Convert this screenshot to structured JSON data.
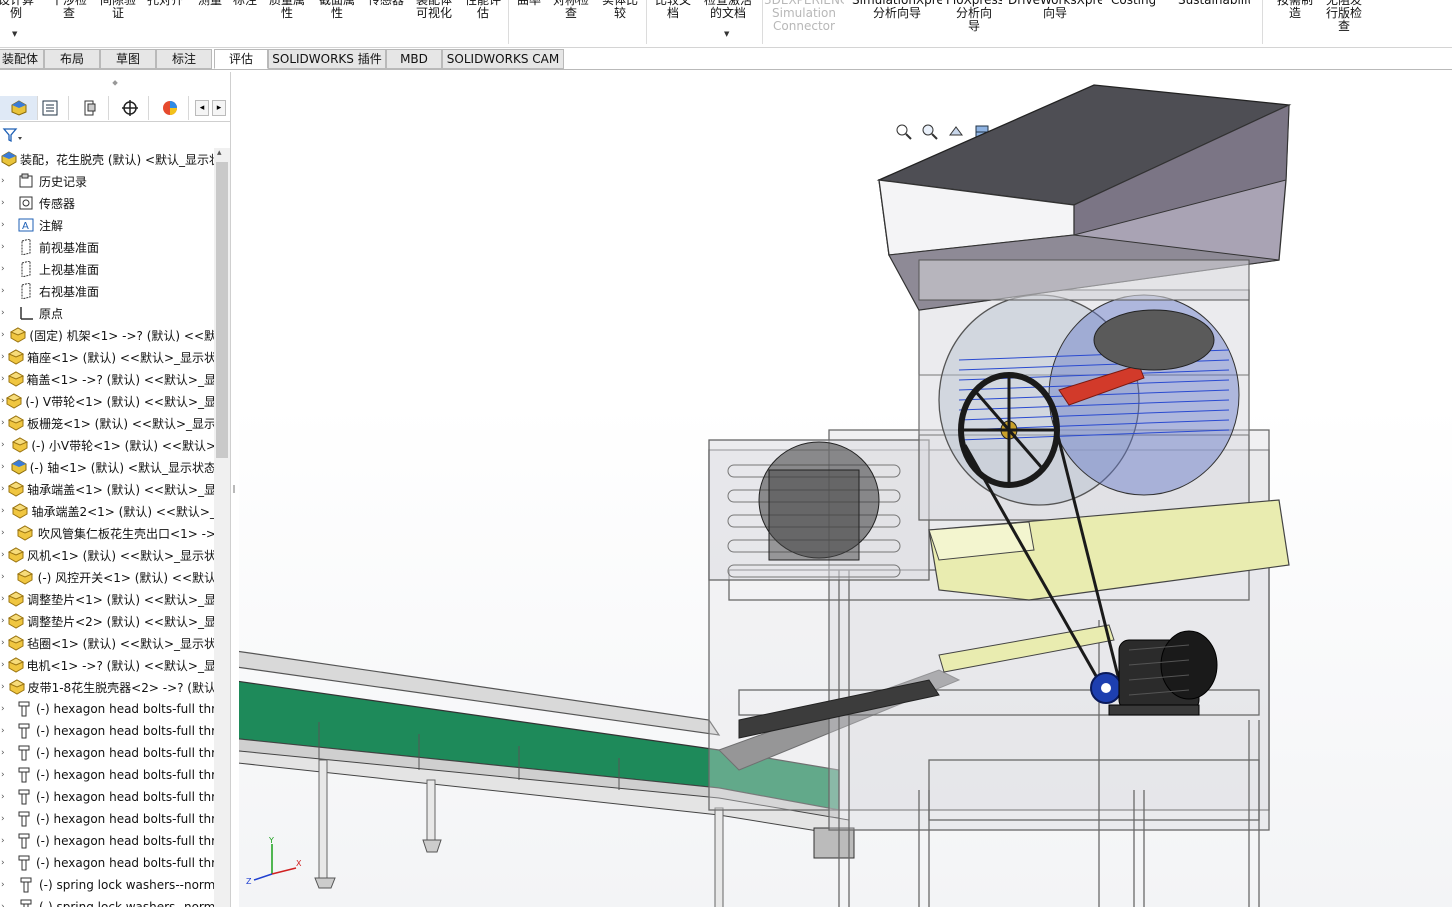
{
  "ribbon": {
    "items": [
      {
        "label": "设计算\n例",
        "disabled": false
      },
      {
        "label": "干涉检\n查",
        "disabled": false
      },
      {
        "label": "间隙验\n证",
        "disabled": false
      },
      {
        "label": "孔对齐",
        "disabled": false
      },
      {
        "label": "测量",
        "disabled": false
      },
      {
        "label": "标注",
        "disabled": false
      },
      {
        "label": "质量属\n性",
        "disabled": false
      },
      {
        "label": "截面属\n性",
        "disabled": false
      },
      {
        "label": "传感器",
        "disabled": false
      },
      {
        "label": "装配体\n可视化",
        "disabled": false
      },
      {
        "label": "性能评\n估",
        "disabled": false
      },
      {
        "label": "曲率",
        "disabled": false
      },
      {
        "label": "对称检\n查",
        "disabled": false
      },
      {
        "label": "实体比\n较",
        "disabled": false
      },
      {
        "label": "比较文\n档",
        "disabled": false
      },
      {
        "label": "检查激活\n的文档",
        "disabled": false
      },
      {
        "label": "3DEXPERIENCE\nSimulation\nConnector",
        "disabled": true
      },
      {
        "label": "SimulationXpress\n分析向导",
        "disabled": false
      },
      {
        "label": "FloXpress\n分析向\n导",
        "disabled": false
      },
      {
        "label": "DriveWorksXpress\n向导",
        "disabled": false
      },
      {
        "label": "Costing",
        "disabled": false
      },
      {
        "label": "Sustainability",
        "disabled": false
      },
      {
        "label": "按需制\n造",
        "disabled": false
      },
      {
        "label": "无阻发\n行版检\n查",
        "disabled": false
      }
    ]
  },
  "tabs": [
    {
      "label": "装配体",
      "active": false
    },
    {
      "label": "布局",
      "active": false
    },
    {
      "label": "草图",
      "active": false
    },
    {
      "label": "标注",
      "active": false
    },
    {
      "label": "评估",
      "active": true
    },
    {
      "label": "SOLIDWORKS 插件",
      "active": false
    },
    {
      "label": "MBD",
      "active": false
    },
    {
      "label": "SOLIDWORKS CAM",
      "active": false
    }
  ],
  "panel": {
    "tabs": [
      "feature-manager",
      "property-manager",
      "configuration-manager",
      "dimxpert-manager",
      "display-manager"
    ]
  },
  "tree": {
    "items": [
      {
        "label": "装配，花生脱壳 (默认) <默认_显示状",
        "icon": "assembly-icon"
      },
      {
        "label": "历史记录",
        "icon": "history-icon"
      },
      {
        "label": "传感器",
        "icon": "sensor-icon"
      },
      {
        "label": "注解",
        "icon": "annotation-icon"
      },
      {
        "label": "前视基准面",
        "icon": "plane-icon"
      },
      {
        "label": "上视基准面",
        "icon": "plane-icon"
      },
      {
        "label": "右视基准面",
        "icon": "plane-icon"
      },
      {
        "label": "原点",
        "icon": "origin-icon"
      },
      {
        "label": "(固定) 机架<1> ->? (默认) <<默",
        "icon": "part-icon"
      },
      {
        "label": "箱座<1> (默认) <<默认>_显示状",
        "icon": "part-icon"
      },
      {
        "label": "箱盖<1> ->? (默认) <<默认>_显",
        "icon": "part-icon"
      },
      {
        "label": "(-) V带轮<1> (默认) <<默认>_显",
        "icon": "part-icon"
      },
      {
        "label": "板栅笼<1> (默认) <<默认>_显示",
        "icon": "part-icon"
      },
      {
        "label": "(-) 小V带轮<1> (默认) <<默认>",
        "icon": "part-icon"
      },
      {
        "label": "(-) 轴<1> (默认) <默认_显示状态",
        "icon": "subassembly-icon"
      },
      {
        "label": "轴承端盖<1> (默认) <<默认>_显",
        "icon": "part-icon"
      },
      {
        "label": "轴承端盖2<1> (默认) <<默认>_",
        "icon": "part-icon"
      },
      {
        "label": "吹风管集仁板花生壳出口<1> ->",
        "icon": "part-icon"
      },
      {
        "label": "风机<1> (默认) <<默认>_显示状",
        "icon": "part-icon"
      },
      {
        "label": "(-) 风控开关<1> (默认) <<默认",
        "icon": "part-icon"
      },
      {
        "label": "调整垫片<1> (默认) <<默认>_显",
        "icon": "part-icon"
      },
      {
        "label": "调整垫片<2> (默认) <<默认>_显",
        "icon": "part-icon"
      },
      {
        "label": "毡圈<1> (默认) <<默认>_显示状",
        "icon": "part-icon"
      },
      {
        "label": "电机<1> ->? (默认) <<默认>_显",
        "icon": "part-icon"
      },
      {
        "label": "皮带1-8花生脱壳器<2> ->? (默认",
        "icon": "part-icon"
      },
      {
        "label": "(-) hexagon head bolts-full thr",
        "icon": "bolt-icon"
      },
      {
        "label": "(-) hexagon head bolts-full thr",
        "icon": "bolt-icon"
      },
      {
        "label": "(-) hexagon head bolts-full thr",
        "icon": "bolt-icon"
      },
      {
        "label": "(-) hexagon head bolts-full thr",
        "icon": "bolt-icon"
      },
      {
        "label": "(-) hexagon head bolts-full thr",
        "icon": "bolt-icon"
      },
      {
        "label": "(-) hexagon head bolts-full thr",
        "icon": "bolt-icon"
      },
      {
        "label": "(-) hexagon head bolts-full thr",
        "icon": "bolt-icon"
      },
      {
        "label": "(-) hexagon head bolts-full thr",
        "icon": "bolt-icon"
      },
      {
        "label": "(-) spring lock washers--norm",
        "icon": "washer-icon"
      },
      {
        "label": "(-) spring lock washers--norm",
        "icon": "washer-icon"
      }
    ]
  },
  "hud": {
    "icons": [
      "zoom-to-fit-icon",
      "zoom-to-area-icon",
      "previous-view-icon",
      "section-view-icon",
      "dynamic-annotation-icon",
      "view-orientation-icon",
      "display-style-icon",
      "hide-show-items-icon",
      "edit-appearance-icon",
      "apply-scene-icon",
      "view-settings-icon"
    ]
  },
  "colors": {
    "accent": "#2f6fbd",
    "conveyor_belt": "#1e8a5a",
    "hopper": "#a9a3b4",
    "chute": "#e9ecb0",
    "motor": "#2b2b2b",
    "pulley": "#1d3fb0"
  }
}
